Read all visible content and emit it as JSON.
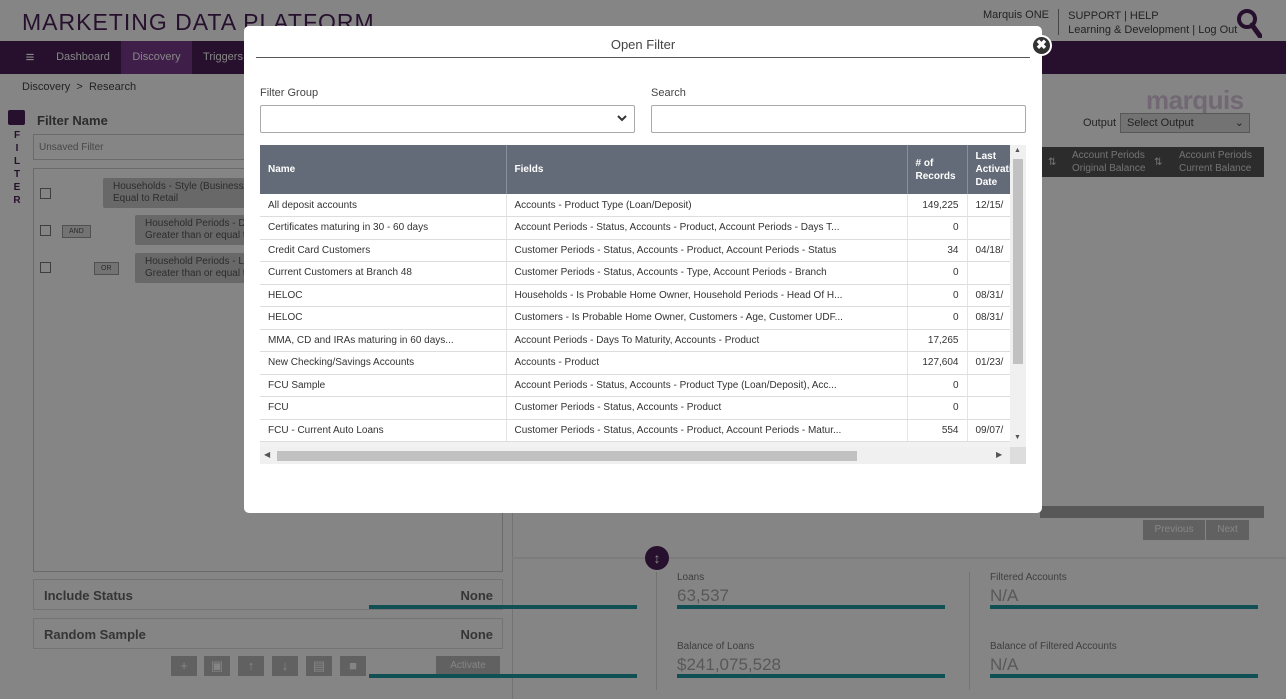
{
  "app": {
    "brand": "MARKETING DATA PLATFORM",
    "user": "Marquis ONE",
    "links_line1": "SUPPORT | HELP",
    "links_line2": "Learning & Development | Log Out",
    "logo": "marquis"
  },
  "nav": {
    "menu_icon": "≡",
    "items": [
      "Dashboard",
      "Discovery",
      "Triggers"
    ],
    "active": "Discovery"
  },
  "breadcrumb": {
    "root": "Discovery",
    "separator": ">",
    "current": "Research"
  },
  "filter": {
    "vertical_label": [
      "F",
      "I",
      "L",
      "T",
      "E",
      "R"
    ],
    "name_label": "Filter Name",
    "name_value": "Unsaved Filter",
    "conditions": [
      {
        "line1": "Households - Style (Business/",
        "line2": "Equal to Retail"
      },
      {
        "op": "AND",
        "line1": "Household Periods - De",
        "line2": "Greater than or equal t"
      },
      {
        "op": "OR",
        "line1": "Household Periods - Lo",
        "line2": "Greater than or equal t"
      }
    ],
    "include_status_label": "Include Status",
    "include_status_value": "None",
    "random_sample_label": "Random Sample",
    "random_sample_value": "None",
    "activate_label": "Activate"
  },
  "output": {
    "label": "Output",
    "select_value": "Select Output"
  },
  "bg_grid": {
    "col1_line1": "Account Periods",
    "col1_line2": "Original Balance",
    "col2_line1": "Account Periods",
    "col2_line2": "Current Balance",
    "previous": "Previous",
    "next": "Next"
  },
  "stats": {
    "loans_label": "Loans",
    "loans_value": "63,537",
    "filtered_label": "Filtered Accounts",
    "filtered_value": "N/A",
    "bal_loans_label": "Balance of Loans",
    "bal_loans_value": "$241,075,528",
    "bal_filtered_label": "Balance of Filtered Accounts",
    "bal_filtered_value": "N/A"
  },
  "modal": {
    "title": "Open Filter",
    "close_glyph": "✖",
    "filter_group_label": "Filter Group",
    "filter_group_value": "",
    "search_label": "Search",
    "search_value": "",
    "columns": {
      "name": "Name",
      "fields": "Fields",
      "records_line1": "# of",
      "records_line2": "Records",
      "last_line1": "Last",
      "last_line2": "Activati",
      "last_line3": "Date"
    },
    "rows": [
      {
        "name": "All deposit accounts",
        "fields": "Accounts - Product Type (Loan/Deposit)",
        "records": "149,225",
        "last": "12/15/"
      },
      {
        "name": "Certificates maturing in 30 - 60 days",
        "fields": "Account Periods - Status, Accounts - Product, Account Periods - Days T...",
        "records": "0",
        "last": ""
      },
      {
        "name": "Credit Card Customers",
        "fields": "Customer Periods - Status, Accounts - Product, Account Periods - Status",
        "records": "34",
        "last": "04/18/"
      },
      {
        "name": "Current Customers at Branch 48",
        "fields": "Customer Periods - Status, Accounts - Type, Account Periods - Branch",
        "records": "0",
        "last": ""
      },
      {
        "name": "HELOC",
        "fields": "Households - Is Probable Home Owner, Household Periods - Head Of H...",
        "records": "0",
        "last": "08/31/"
      },
      {
        "name": "HELOC",
        "fields": "Customers - Is Probable Home Owner, Customers - Age, Customer UDF...",
        "records": "0",
        "last": "08/31/"
      },
      {
        "name": "MMA, CD and IRAs maturing in 60 days...",
        "fields": "Account Periods - Days To Maturity, Accounts - Product",
        "records": "17,265",
        "last": ""
      },
      {
        "name": "New Checking/Savings Accounts",
        "fields": "Accounts - Product",
        "records": "127,604",
        "last": "01/23/"
      },
      {
        "name": "FCU Sample",
        "fields": "Account Periods - Status, Accounts - Product Type (Loan/Deposit), Acc...",
        "records": "0",
        "last": ""
      },
      {
        "name": "FCU",
        "fields": "Customer Periods - Status, Accounts - Product",
        "records": "0",
        "last": ""
      },
      {
        "name": "FCU - Current Auto Loans",
        "fields": "Customer Periods - Status, Accounts - Product, Account Periods - Matur...",
        "records": "554",
        "last": "09/07/"
      }
    ]
  },
  "colors": {
    "brand_purple": "#4a1f57",
    "nav_active": "#7b3b8e",
    "table_header": "#646b78",
    "stat_bar": "#1f9aa4"
  }
}
